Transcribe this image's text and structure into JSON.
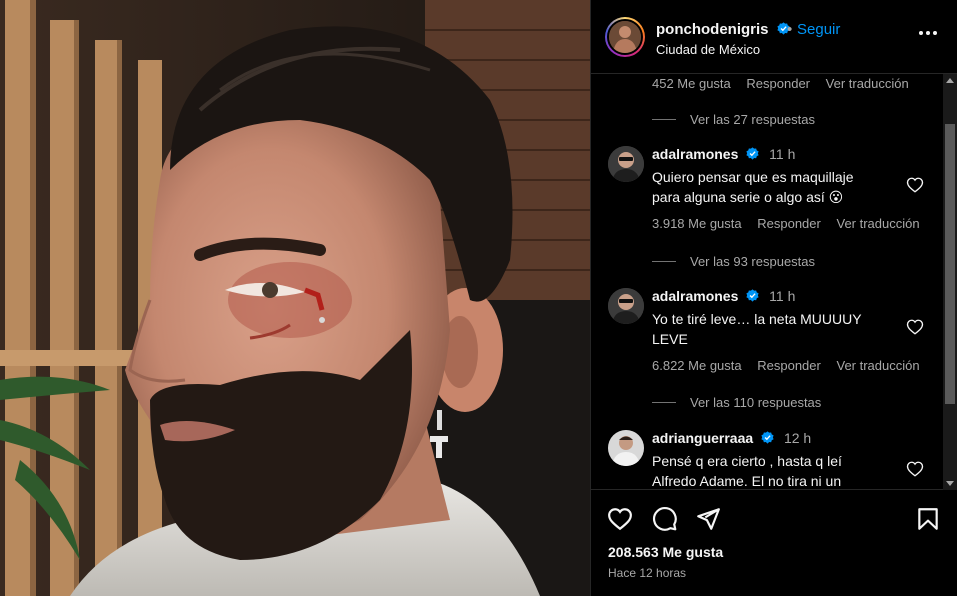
{
  "post": {
    "author": "ponchodenigris",
    "follow_label": "Seguir",
    "separator": "•",
    "location": "Ciudad de México",
    "likes_text": "208.563 Me gusta",
    "time_text": "Hace 12 horas"
  },
  "comments_area": {
    "top_meta": {
      "likes": "452 Me gusta",
      "reply": "Responder",
      "translate": "Ver traducción"
    },
    "top_replies": "Ver las 27 respuestas",
    "comments": [
      {
        "username": "adalramones",
        "time": "11 h",
        "text_line1": "Quiero pensar que es maquillaje",
        "text_line2": "para alguna serie o algo así 😮",
        "likes": "3.918 Me gusta",
        "reply": "Responder",
        "translate": "Ver traducción",
        "replies": "Ver las 93 respuestas"
      },
      {
        "username": "adalramones",
        "time": "11 h",
        "text_line1": "Yo te tiré leve… la neta MUUUUY",
        "text_line2": "LEVE",
        "likes": "6.822 Me gusta",
        "reply": "Responder",
        "translate": "Ver traducción",
        "replies": "Ver las 110 respuestas"
      },
      {
        "username": "adrianguerraaa",
        "time": "12 h",
        "text_line1": "Pensé q era cierto , hasta q leí",
        "text_line2": "Alfredo Adame. El no tira ni un"
      }
    ]
  },
  "icons": {
    "verified": "verified-badge-icon",
    "more": "more-options-icon",
    "like": "heart-icon",
    "comment": "comment-icon",
    "share": "share-icon",
    "save": "bookmark-icon"
  },
  "colors": {
    "background": "#000000",
    "link_blue": "#0095f6",
    "secondary_text": "#a8a8a8",
    "verified_blue": "#0095f6"
  }
}
